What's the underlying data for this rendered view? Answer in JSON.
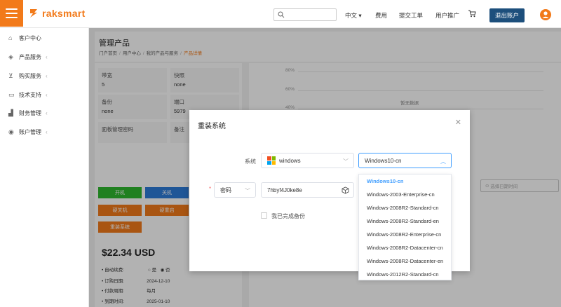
{
  "brand": {
    "name": "raksmart",
    "color": "#f27a1a"
  },
  "header": {
    "search_placeholder": "",
    "nav": [
      {
        "label": "中文 ▾"
      },
      {
        "label": "费用"
      },
      {
        "label": "提交工单"
      },
      {
        "label": "用户推广"
      }
    ],
    "logout_label": "退出账户"
  },
  "sidebar": {
    "items": [
      {
        "label": "客户中心",
        "icon": "home-icon",
        "chevron": ""
      },
      {
        "label": "产品服务",
        "icon": "cube-icon",
        "chevron": "‹"
      },
      {
        "label": "购买服务",
        "icon": "cart-icon",
        "chevron": "‹"
      },
      {
        "label": "技术支持",
        "icon": "monitor-icon",
        "chevron": "‹"
      },
      {
        "label": "财务管理",
        "icon": "bank-icon",
        "chevron": "‹"
      },
      {
        "label": "账户管理",
        "icon": "user-icon",
        "chevron": "‹"
      }
    ]
  },
  "page": {
    "title": "管理产品",
    "breadcrumb": [
      "门户首页",
      "用户中心",
      "我的产品与服务",
      "产品详情"
    ]
  },
  "info": {
    "bandwidth_label": "带宽",
    "bandwidth_value": "5",
    "snapshot_label": "快照",
    "snapshot_value": "none",
    "backup_label": "备份",
    "backup_value": "none",
    "port_label": "端口",
    "port_value": "5979",
    "panel_pwd_label": "面板管理密码",
    "note_label": "备注"
  },
  "actions": {
    "power_on": "开机",
    "power_off": "关机",
    "hard_off": "硬关机",
    "hard_reboot": "硬重启",
    "reinstall": "重装系统"
  },
  "billing": {
    "price": "$22.34 USD",
    "auto_renew_label": "自动续费:",
    "auto_renew_yes": "是",
    "auto_renew_no": "否",
    "order_date_label": "订购日期:",
    "order_date": "2024-12-10",
    "cycle_label": "付款周期:",
    "cycle": "每月",
    "due_label": "到期时间:",
    "due": "2025-01-10"
  },
  "chart_bg": {
    "ticks": [
      "80%",
      "60%",
      "40%"
    ],
    "empty_text": "暂无数据",
    "date_placeholder": "选择日期时间"
  },
  "modal": {
    "title": "重装系统",
    "system_label": "系统",
    "os_family": "windows",
    "os_version": "Windows10-cn",
    "password_type": "密码",
    "password_value": "7hbyf4J0ke8e",
    "backup_confirm": "我已完成备份"
  },
  "dropdown": {
    "options": [
      "Windows10-cn",
      "Windows-2003-Enterprise-cn",
      "Windows-2008R2-Standard-cn",
      "Windows-2008R2-Standard-en",
      "Windows-2008R2-Enterprise-cn",
      "Windows-2008R2-Datacenter-cn",
      "Windows-2008R2-Datacenter-en",
      "Windows-2012R2-Standard-cn"
    ]
  }
}
